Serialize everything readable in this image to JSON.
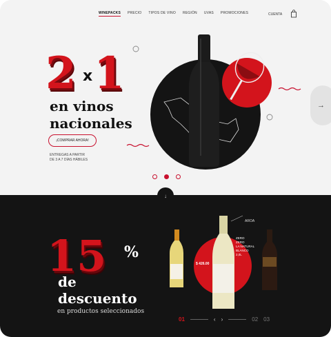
{
  "nav": {
    "links": [
      "WINEPACKS",
      "PRECIO",
      "TIPOS DE VINO",
      "REGIÓN",
      "UVAS",
      "PROMOCIONES"
    ],
    "account": "CUENTA",
    "cart_icon": "shopping-bag-icon"
  },
  "hero": {
    "big_left": "2",
    "big_x": "x",
    "big_right": "1",
    "headline_line1": "en vinos",
    "headline_line2": "nacionales",
    "cta": "¡COMPRAR AHORA!",
    "note_line1": "ENTREGAS A PARTIR",
    "note_line2": "DE 3 A 7 DÍAS HÁBILES",
    "slides_total": 3,
    "active_slide": 2,
    "next_icon": "arrow-right-icon"
  },
  "promo": {
    "percent": "15",
    "percent_sign": "%",
    "line1": "de",
    "line2": "descuento",
    "subtitle": "en productos seleccionados",
    "price": "$ 426.00",
    "product_label": "AROA",
    "product_desc": [
      "ZERO",
      "ZERO",
      "LA NATURAL",
      "BLANCO",
      "2,0L"
    ],
    "pager_active": "01",
    "pager_next": "02",
    "pager_last": "03"
  },
  "colors": {
    "accent": "#c8102e",
    "dark": "#141414",
    "light": "#f3f3f3"
  }
}
